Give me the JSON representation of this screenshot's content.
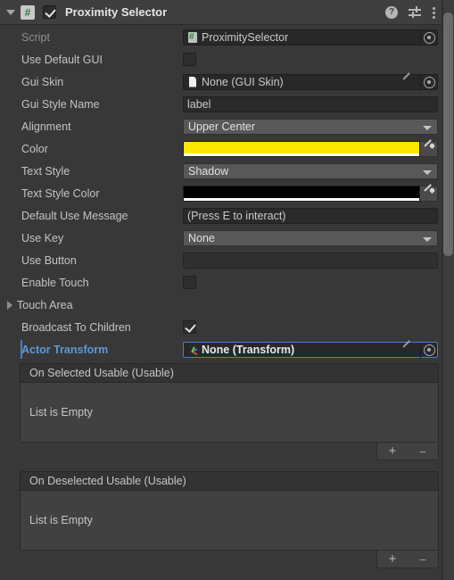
{
  "header": {
    "title": "Proximity Selector",
    "enabled": true,
    "foldout_open": true,
    "script_badge": "#",
    "icons": [
      {
        "name": "help-icon",
        "glyph": "?"
      },
      {
        "name": "preset-icon",
        "glyph": "preset"
      },
      {
        "name": "more-menu-icon",
        "glyph": "⋮"
      }
    ]
  },
  "properties": [
    {
      "label": "Script",
      "type": "object",
      "value": "ProximitySelector",
      "icon": "script-icon",
      "dimmed": true,
      "pencil": false,
      "highlighted": false
    },
    {
      "label": "Use Default GUI",
      "type": "checkbox",
      "value": false
    },
    {
      "label": "Gui Skin",
      "type": "object",
      "value": "None (GUI Skin)",
      "icon": "document-icon",
      "dimmed": false,
      "pencil": true,
      "highlighted": false
    },
    {
      "label": "Gui Style Name",
      "type": "text",
      "value": "label"
    },
    {
      "label": "Alignment",
      "type": "dropdown",
      "value": "Upper Center"
    },
    {
      "label": "Color",
      "type": "color",
      "value": "#FFE800",
      "alpha_color": "#FFFFFF"
    },
    {
      "label": "Text Style",
      "type": "dropdown",
      "value": "Shadow"
    },
    {
      "label": "Text Style Color",
      "type": "color",
      "value": "#000000",
      "alpha_color": "#FFFFFF"
    },
    {
      "label": "Default Use Message",
      "type": "text",
      "value": "(Press E to interact)"
    },
    {
      "label": "Use Key",
      "type": "dropdown",
      "value": "None"
    },
    {
      "label": "Use Button",
      "type": "text",
      "value": ""
    },
    {
      "label": "Enable Touch",
      "type": "checkbox",
      "value": false
    },
    {
      "label": "Touch Area",
      "type": "foldout",
      "expanded": false
    },
    {
      "label": "Broadcast To Children",
      "type": "checkbox",
      "value": true
    },
    {
      "label": "Actor Transform",
      "type": "object",
      "value": "None (Transform)",
      "icon": "transform-gizmo-icon",
      "dimmed": false,
      "pencil": true,
      "highlighted": true
    }
  ],
  "events": [
    {
      "title": "On Selected Usable (Usable)",
      "empty_text": "List is Empty",
      "add_label": "+",
      "remove_label": "−"
    },
    {
      "title": "On Deselected Usable (Usable)",
      "empty_text": "List is Empty",
      "add_label": "+",
      "remove_label": "−"
    }
  ],
  "colors": {
    "panel_bg": "#383838",
    "header_bg": "#3F3F3F",
    "accent_blue": "#3D83D4",
    "label_blue": "#5B9BD5",
    "color_value": "#FFE800"
  }
}
